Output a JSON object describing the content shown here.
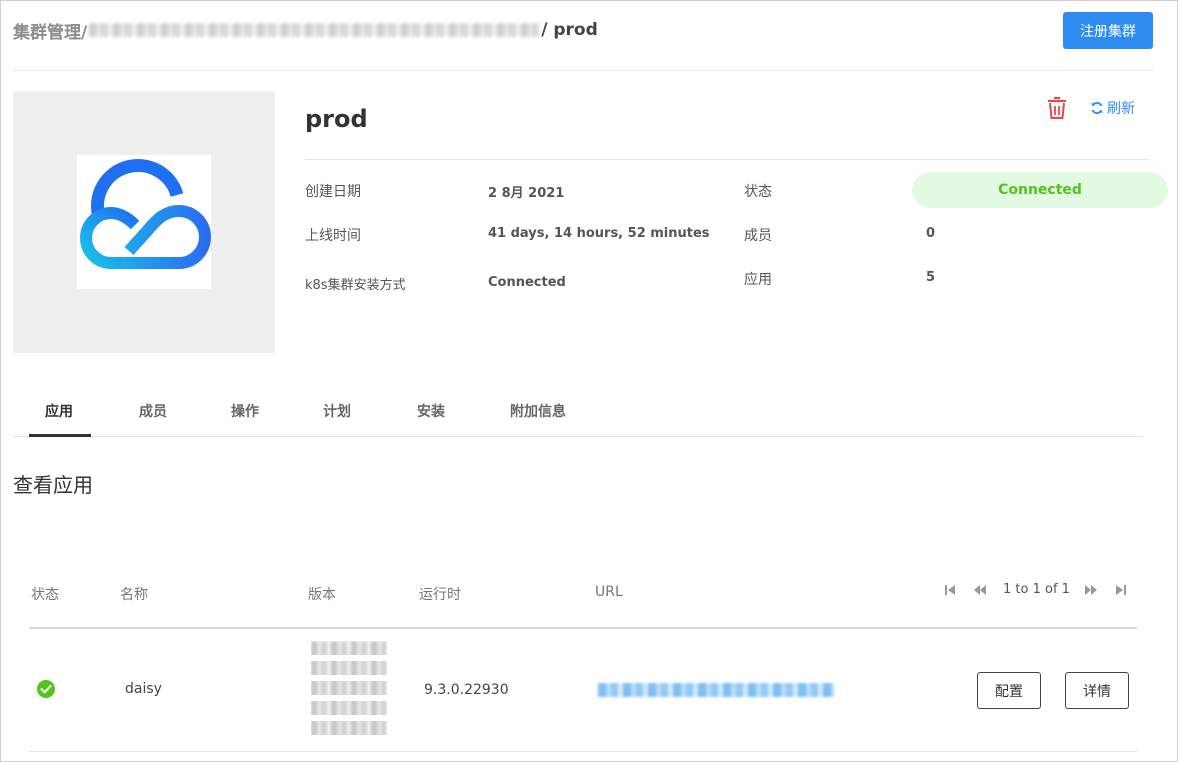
{
  "breadcrumb": {
    "root": "集群管理/",
    "current": "/ prod"
  },
  "header": {
    "register_button": "注册集群"
  },
  "cluster": {
    "name": "prod",
    "refresh_label": "刷新",
    "info": {
      "created_label": "创建日期",
      "created_value": "2 8月 2021",
      "uptime_label": "上线时间",
      "uptime_value": "41 days, 14 hours, 52 minutes",
      "install_label": "k8s集群安装方式",
      "install_value": "Connected",
      "status_label": "状态",
      "status_value": "Connected",
      "members_label": "成员",
      "members_value": "0",
      "apps_label": "应用",
      "apps_value": "5"
    }
  },
  "tabs": [
    {
      "label": "应用",
      "active": true
    },
    {
      "label": "成员",
      "active": false
    },
    {
      "label": "操作",
      "active": false
    },
    {
      "label": "计划",
      "active": false
    },
    {
      "label": "安装",
      "active": false
    },
    {
      "label": "附加信息",
      "active": false
    }
  ],
  "section_title": "查看应用",
  "table": {
    "columns": [
      "状态",
      "名称",
      "版本",
      "运行时",
      "URL"
    ],
    "pagination": "1 to 1 of 1",
    "rows": [
      {
        "status": "ok",
        "name": "daisy",
        "runtime": "9.3.0.22930",
        "config_button": "配置",
        "detail_button": "详情"
      }
    ]
  },
  "colors": {
    "primary": "#2d8cf0",
    "success": "#52c41a",
    "danger": "#e8464b"
  }
}
